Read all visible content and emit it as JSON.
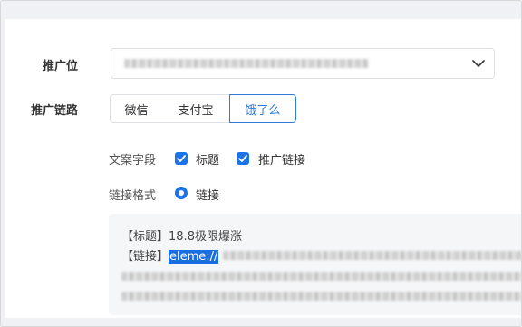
{
  "form": {
    "promotion_position_label": "推广位",
    "promotion_link_label": "推广链路",
    "link_channels": [
      {
        "label": "微信",
        "active": false
      },
      {
        "label": "支付宝",
        "active": false
      },
      {
        "label": "饿了么",
        "active": true
      }
    ],
    "copy_fields_label": "文案字段",
    "copy_fields": [
      {
        "label": "标题",
        "checked": true
      },
      {
        "label": "推广链接",
        "checked": true
      }
    ],
    "link_format_label": "链接格式",
    "link_format_option": "链接"
  },
  "preview": {
    "line1_prefix": "【标题】",
    "line1_value": "18.8极限爆涨",
    "line2_prefix": "【链接】",
    "line2_selected": "eleme://"
  },
  "colors": {
    "accent": "#2f7bd8",
    "checkbox": "#1a73e8",
    "selection": "#1a6fe0"
  }
}
